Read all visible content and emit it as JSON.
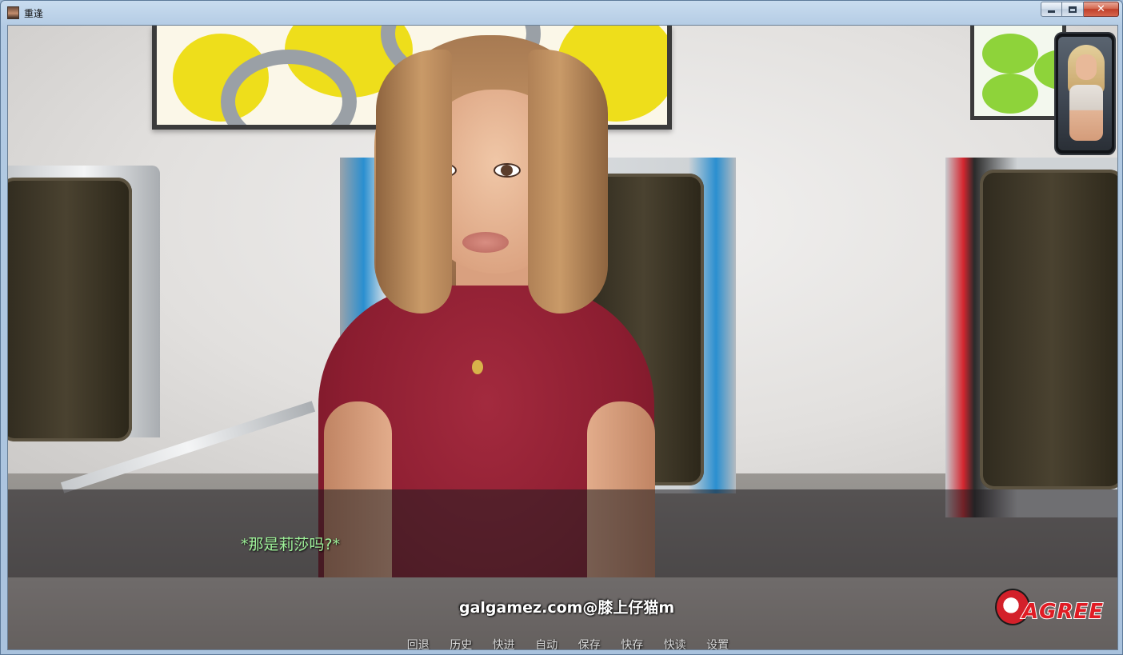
{
  "window": {
    "title": "重逢",
    "controls": {
      "minimize": "minimize",
      "maximize": "maximize",
      "close": "✕"
    }
  },
  "scene": {
    "dialogue": "*那是莉莎吗?*",
    "watermark": "galgamez.com@膝上仔猫m"
  },
  "quick_menu": [
    {
      "id": "rollback",
      "label": "回退"
    },
    {
      "id": "history",
      "label": "历史"
    },
    {
      "id": "skip",
      "label": "快进"
    },
    {
      "id": "auto",
      "label": "自动"
    },
    {
      "id": "save",
      "label": "保存"
    },
    {
      "id": "quick-save",
      "label": "快存"
    },
    {
      "id": "quick-load",
      "label": "快读"
    },
    {
      "id": "settings",
      "label": "设置"
    }
  ],
  "logo": {
    "text": "AGREE"
  },
  "colors": {
    "dialogue_text": "#9ff29a",
    "shirt": "#8b1d30",
    "logo": "#e01c24"
  }
}
